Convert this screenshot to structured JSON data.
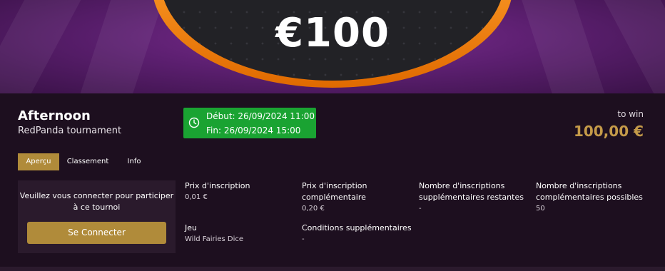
{
  "banner": {
    "prize_text": "€100",
    "colors": {
      "background": "#5c1f70",
      "ring": "#f28a1a",
      "chip": "#222226"
    }
  },
  "tournament": {
    "title": "Afternoon",
    "subtitle": "RedPanda tournament",
    "start": "Début: 26/09/2024 11:00",
    "end": "Fin: 26/09/2024 15:00",
    "to_win_label": "to win",
    "prize_value": "100,00 €",
    "icon": "clock-icon"
  },
  "tabs": [
    {
      "label": "Aperçu",
      "active": true
    },
    {
      "label": "Classement",
      "active": false
    },
    {
      "label": "Info",
      "active": false
    }
  ],
  "login": {
    "message": "Veuillez vous connecter pour participer à ce tournoi",
    "button_label": "Se Connecter"
  },
  "details": [
    {
      "label": "Prix d'inscription",
      "value": "0,01 €"
    },
    {
      "label": "Prix d'inscription complémentaire",
      "value": "0,20 €"
    },
    {
      "label": "Nombre d'inscriptions supplémentaires restantes",
      "value": "-"
    },
    {
      "label": "Nombre d'inscriptions complémentaires possibles",
      "value": "50"
    },
    {
      "label": "Jeu",
      "value": "Wild Fairies Dice"
    },
    {
      "label": "Conditions supplémentaires",
      "value": "-"
    }
  ],
  "colors": {
    "accent": "#b08b3a",
    "prize": "#c49a49",
    "date_box": "#1aa332",
    "page_bg": "#1d0f1f"
  }
}
